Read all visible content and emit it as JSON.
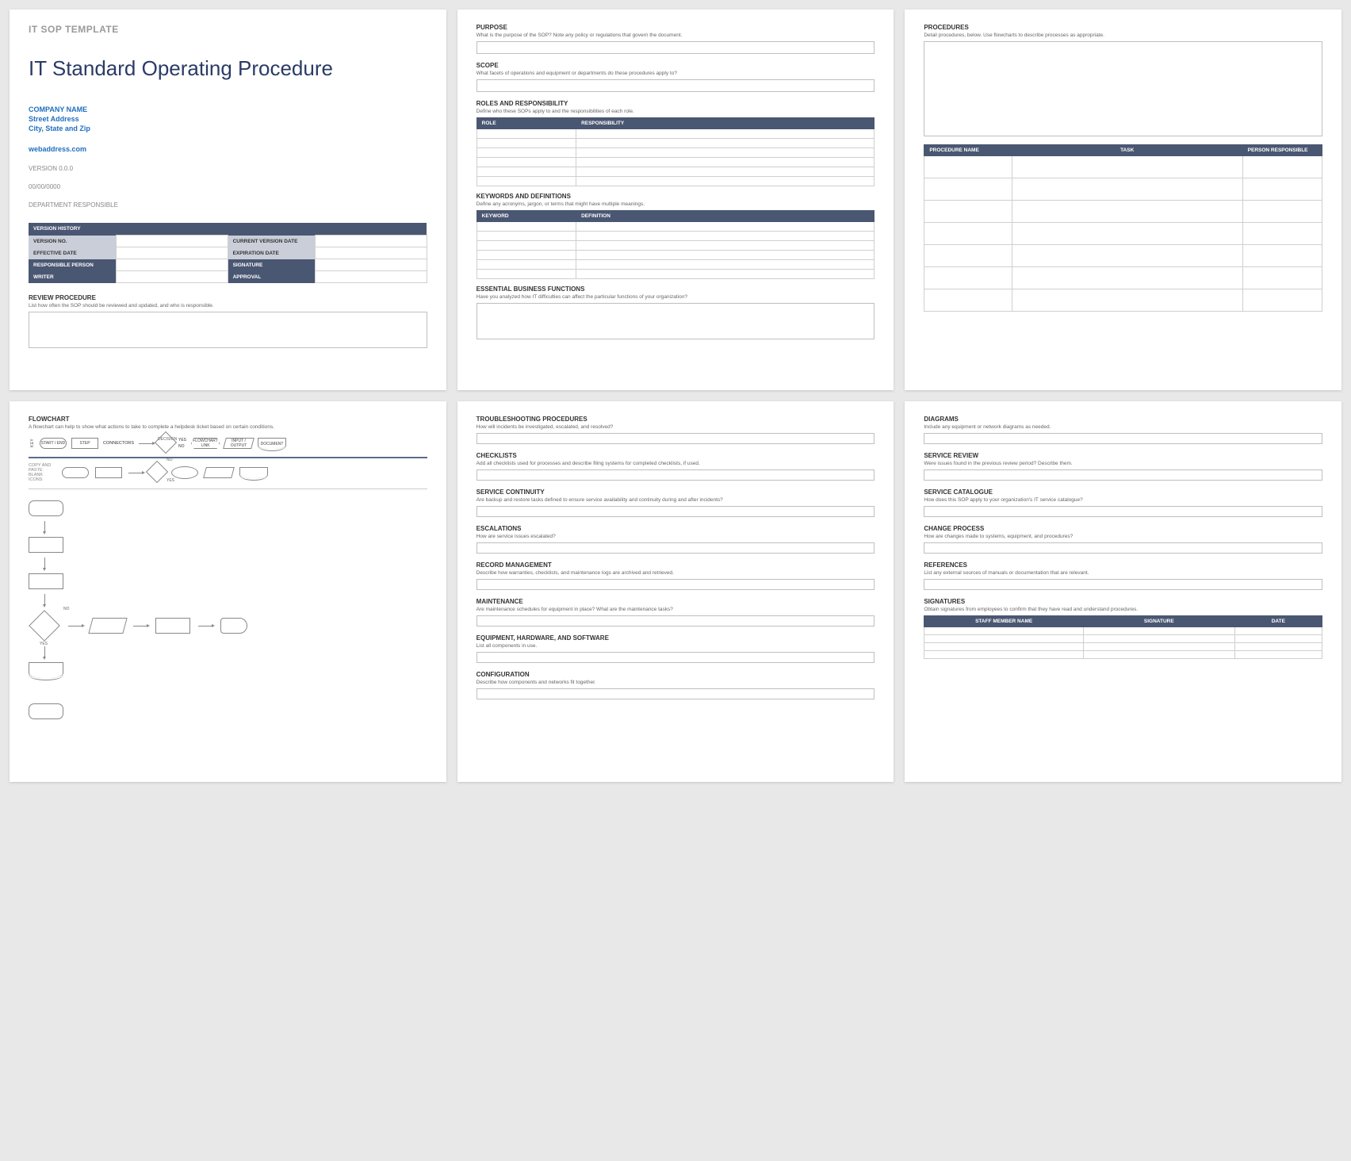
{
  "page1": {
    "template_label": "IT SOP TEMPLATE",
    "title": "IT Standard Operating Procedure",
    "company_name": "COMPANY NAME",
    "street": "Street Address",
    "city": "City, State and Zip",
    "web": "webaddress.com",
    "version": "VERSION 0.0.0",
    "date": "00/00/0000",
    "department": "DEPARTMENT RESPONSIBLE",
    "vh_header": "VERSION HISTORY",
    "vh_rows": {
      "r1a": "VERSION NO.",
      "r1b": "CURRENT VERSION DATE",
      "r2a": "EFFECTIVE DATE",
      "r2b": "EXPIRATION DATE",
      "r3a": "RESPONSIBLE PERSON",
      "r3b": "SIGNATURE",
      "r4a": "WRITER",
      "r4b": "APPROVAL"
    },
    "review_h": "REVIEW PROCEDURE",
    "review_sub": "List how often the SOP should be reviewed and updated, and who is responsible."
  },
  "page2": {
    "purpose_h": "PURPOSE",
    "purpose_sub": "What is the purpose of the SOP? Note any policy or regulations that govern the document.",
    "scope_h": "SCOPE",
    "scope_sub": "What facets of operations and equipment or departments do these procedures apply to?",
    "roles_h": "ROLES AND RESPONSIBILITY",
    "roles_sub": "Define who these SOPs apply to and the responsibilities of each role.",
    "roles_th1": "ROLE",
    "roles_th2": "RESPONSIBILITY",
    "kw_h": "KEYWORDS AND DEFINITIONS",
    "kw_sub": "Define any acronyms, jargon, or terms that might have multiple meanings.",
    "kw_th1": "KEYWORD",
    "kw_th2": "DEFINITION",
    "ebf_h": "ESSENTIAL BUSINESS FUNCTIONS",
    "ebf_sub": "Have you analyzed how IT difficulties can affect the particular functions of your organization?"
  },
  "page3": {
    "h": "PROCEDURES",
    "sub": "Detail procedures, below.  Use flowcharts to describe processes as appropriate.",
    "th1": "PROCEDURE NAME",
    "th2": "TASK",
    "th3": "PERSON RESPONSIBLE"
  },
  "page4": {
    "h": "FLOWCHART",
    "sub": "A flowchart can help to show what actions to take to complete a helpdesk ticket based on certain conditions.",
    "key": "KEY",
    "k_start": "START / END",
    "k_step": "STEP",
    "k_conn": "CONNECTORS",
    "k_dec": "DECISION",
    "k_yes": "YES",
    "k_no": "NO",
    "k_link": "FLOWCHART LINK",
    "k_io": "INPUT / OUTPUT",
    "k_doc": "DOCUMENT",
    "copy_lbl": "COPY AND PASTE BLANK ICONS"
  },
  "page5": {
    "s1": "TROUBLESHOOTING PROCEDURES",
    "s1sub": "How will incidents be investigated, escalated, and resolved?",
    "s2": "CHECKLISTS",
    "s2sub": "Add all checklists used for processes and describe filing systems for completed checklists, if used.",
    "s3": "SERVICE CONTINUITY",
    "s3sub": "Are backup and restore tasks defined to ensure service availability and continuity during and after incidents?",
    "s4": "ESCALATIONS",
    "s4sub": "How are service issues escalated?",
    "s5": "RECORD MANAGEMENT",
    "s5sub": "Describe how warranties, checklists, and maintenance logs are archived and retrieved.",
    "s6": "MAINTENANCE",
    "s6sub": "Are maintenance schedules for equipment in place? What are the maintenance tasks?",
    "s7": "EQUIPMENT, HARDWARE, AND SOFTWARE",
    "s7sub": "List all components in use.",
    "s8": "CONFIGURATION",
    "s8sub": "Describe how components and networks fit together."
  },
  "page6": {
    "s1": "DIAGRAMS",
    "s1sub": "Include any equipment or network diagrams as needed.",
    "s2": "SERVICE REVIEW",
    "s2sub": "Were issues found in the previous review period? Describe them.",
    "s3": "SERVICE CATALOGUE",
    "s3sub": "How does this SOP apply to your organization's IT service catalogue?",
    "s4": "CHANGE PROCESS",
    "s4sub": "How are changes made to systems, equipment, and procedures?",
    "s5": "REFERENCES",
    "s5sub": "List any external sources of manuals or documentation that are relevant.",
    "s6": "SIGNATURES",
    "s6sub": "Obtain signatures from employees to confirm that they have read and understand procedures.",
    "th1": "STAFF MEMBER NAME",
    "th2": "SIGNATURE",
    "th3": "DATE"
  }
}
